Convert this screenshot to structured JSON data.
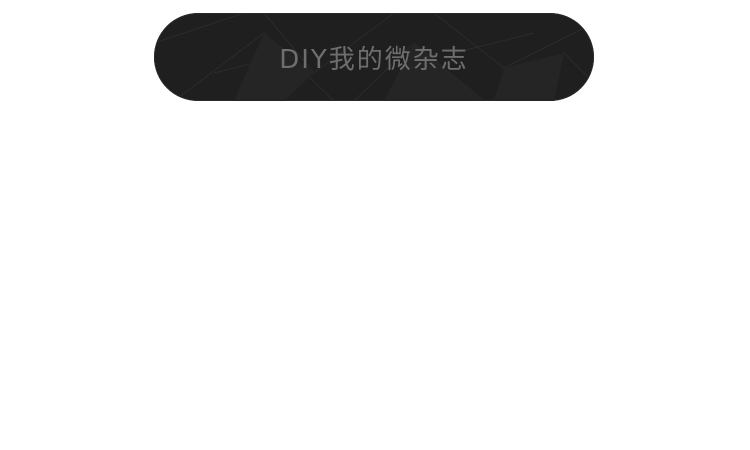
{
  "button": {
    "label": "DIY我的微杂志"
  },
  "colors": {
    "background": "#ffffff",
    "button_bg": "#1f1f1f",
    "button_text": "#6e6e6e"
  }
}
